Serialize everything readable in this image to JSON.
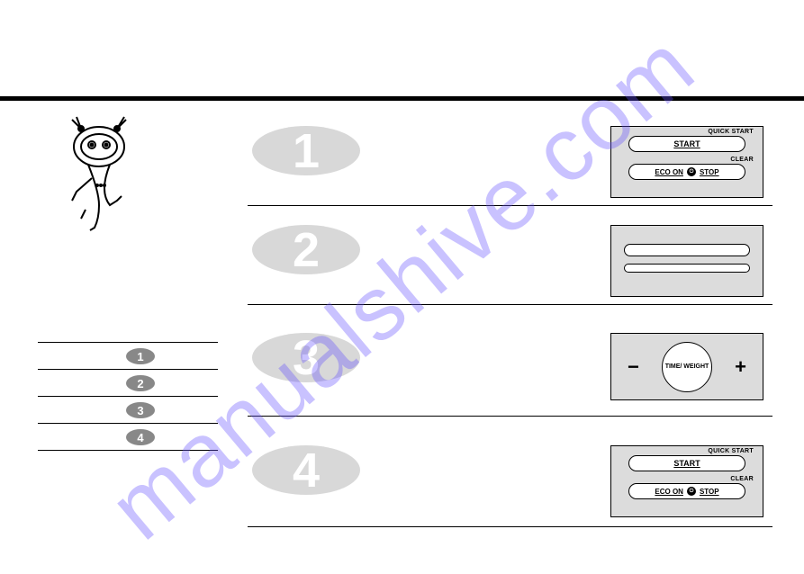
{
  "watermark": "manualshive.com",
  "steps": {
    "s1": "1",
    "s2": "2",
    "s3": "3",
    "s4": "4"
  },
  "sidebar": {
    "n1": "1",
    "n2": "2",
    "n3": "3",
    "n4": "4"
  },
  "panel1": {
    "quickStart": "QUICK START",
    "start": "START",
    "clear": "CLEAR",
    "ecoOn": "ECO ON",
    "stop": "STOP"
  },
  "panel3": {
    "minus": "−",
    "plus": "+",
    "dial": "TIME/ WEIGHT"
  },
  "panel4": {
    "quickStart": "QUICK START",
    "start": "START",
    "clear": "CLEAR",
    "ecoOn": "ECO ON",
    "stop": "STOP"
  }
}
